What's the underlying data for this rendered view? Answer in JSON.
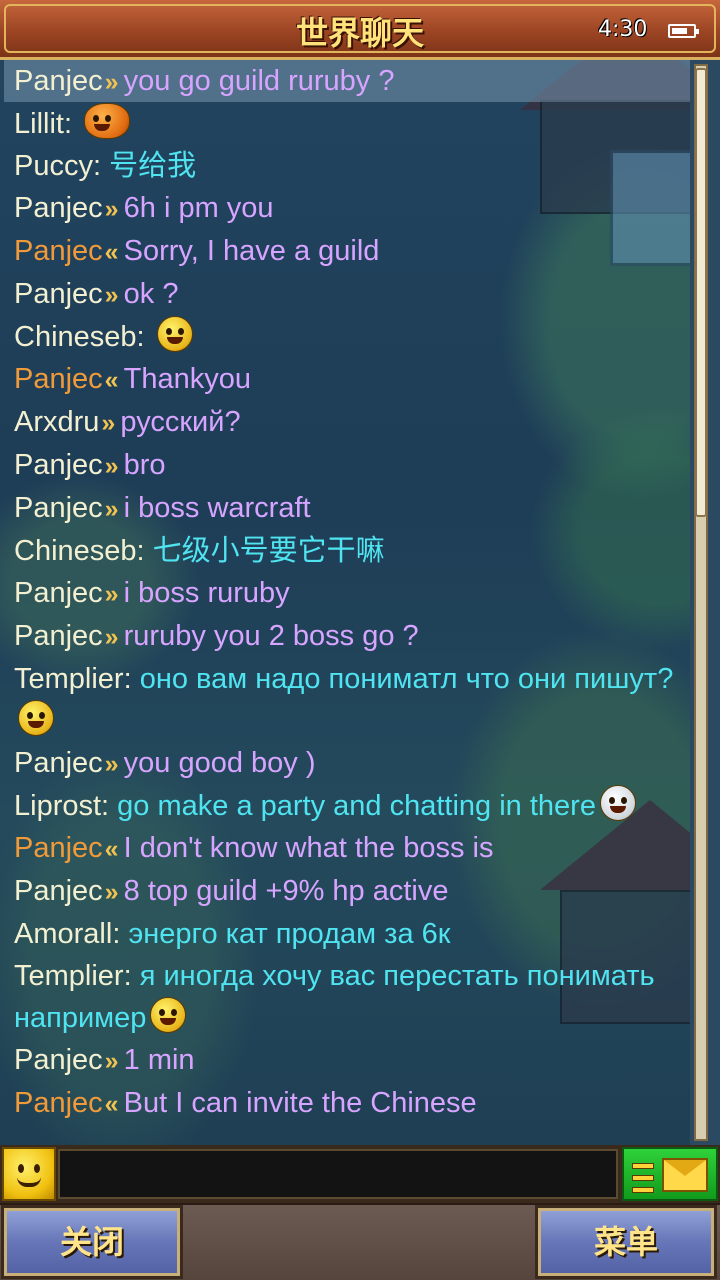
{
  "header": {
    "title": "世界聊天",
    "clock": "4:30",
    "battery_level": 0.75
  },
  "chat": {
    "messages": [
      {
        "name": "Panjec",
        "kind": "arrow-out",
        "text": "you go guild ruruby ?"
      },
      {
        "name": "Lillit",
        "kind": "colon",
        "text": "",
        "emoji": "pumpkin-emoji"
      },
      {
        "name": "Puccy",
        "kind": "colon",
        "text": "号给我"
      },
      {
        "name": "Panjec",
        "kind": "arrow-out",
        "text": "6h i pm you"
      },
      {
        "name": "Panjec",
        "kind": "arrow-in",
        "text": "Sorry, I have a guild"
      },
      {
        "name": "Panjec",
        "kind": "arrow-out",
        "text": "ok ?"
      },
      {
        "name": "Chineseb",
        "kind": "colon",
        "text": "",
        "emoji": "shocked-emoji"
      },
      {
        "name": "Panjec",
        "kind": "arrow-in",
        "text": "Thankyou"
      },
      {
        "name": "Arxdru",
        "kind": "arrow-out",
        "text": "русский?"
      },
      {
        "name": "Panjec",
        "kind": "arrow-out",
        "text": "bro"
      },
      {
        "name": "Panjec",
        "kind": "arrow-out",
        "text": "i boss warcraft"
      },
      {
        "name": "Chineseb",
        "kind": "colon",
        "text": "七级小号要它干嘛"
      },
      {
        "name": "Panjec",
        "kind": "arrow-out",
        "text": "i boss ruruby"
      },
      {
        "name": "Panjec",
        "kind": "arrow-out",
        "text": "ruruby you 2 boss go ?"
      },
      {
        "name": "Templier",
        "kind": "colon",
        "text": "оно вам надо пониматл что они пишут?",
        "emoji": "laughing-emoji"
      },
      {
        "name": "Panjec",
        "kind": "arrow-out",
        "text": "you good boy )"
      },
      {
        "name": "Liprost",
        "kind": "colon",
        "text": "go make a party and chatting in there",
        "emoji": "scared-emoji"
      },
      {
        "name": "Panjec",
        "kind": "arrow-in",
        "text": "I don't know what the boss is"
      },
      {
        "name": "Panjec",
        "kind": "arrow-out",
        "text": "8 top guild +9% hp active"
      },
      {
        "name": "Amorall",
        "kind": "colon",
        "text": "энерго кат продам за 6к"
      },
      {
        "name": "Templier",
        "kind": "colon",
        "text": "я иногда хочу вас перестать понимать например",
        "emoji": "laughing-emoji"
      },
      {
        "name": "Panjec",
        "kind": "arrow-out",
        "text": "1 min"
      },
      {
        "name": "Panjec",
        "kind": "arrow-in",
        "text": "But I can invite the Chinese"
      }
    ],
    "arrow_out": "»",
    "arrow_in": "«",
    "colon": ":",
    "scroll_position": 0.0,
    "scroll_visible_fraction": 0.42
  },
  "input": {
    "value": "",
    "placeholder": ""
  },
  "buttons": {
    "close_label": "关闭",
    "menu_label": "菜单"
  },
  "colors": {
    "name": "#f3f0d2",
    "name_incoming": "#f19a3a",
    "private_text": "#d7a5ff",
    "public_text": "#4fe4f0",
    "arrow": "#f3c350"
  }
}
